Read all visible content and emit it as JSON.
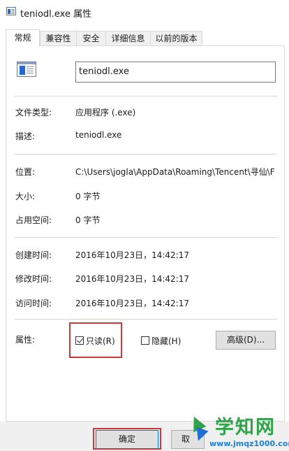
{
  "window": {
    "title": "teniodl.exe 属性"
  },
  "tabs": [
    {
      "label": "常规",
      "active": true
    },
    {
      "label": "兼容性",
      "active": false
    },
    {
      "label": "安全",
      "active": false
    },
    {
      "label": "详细信息",
      "active": false
    },
    {
      "label": "以前的版本",
      "active": false
    }
  ],
  "general": {
    "file_name": "teniodl.exe",
    "rows": {
      "type": {
        "label": "文件类型:",
        "value": "应用程序 (.exe)"
      },
      "description": {
        "label": "描述:",
        "value": "teniodl.exe"
      },
      "location": {
        "label": "位置:",
        "value": "C:\\Users\\jogla\\AppData\\Roaming\\Tencent\\寻仙\\F"
      },
      "size": {
        "label": "大小:",
        "value": "0 字节"
      },
      "size_on_disk": {
        "label": "占用空间:",
        "value": "0 字节"
      },
      "created": {
        "label": "创建时间:",
        "value": "2016年10月23日，14:42:17"
      },
      "modified": {
        "label": "修改时间:",
        "value": "2016年10月23日，14:42:17"
      },
      "accessed": {
        "label": "访问时间:",
        "value": "2016年10月23日，14:42:17"
      }
    },
    "attributes": {
      "label": "属性:",
      "readonly": {
        "label": "只读(R)",
        "checked": true
      },
      "hidden": {
        "label": "隐藏(H)",
        "checked": false
      },
      "advanced_button": "高级(D)..."
    }
  },
  "footer": {
    "ok_label": "确定",
    "cancel_label": "取"
  },
  "watermark": {
    "brand": "学知网",
    "url": "www.jmqz1000.com"
  },
  "colors": {
    "highlight": "#c9383b",
    "focus_border": "#0078d7",
    "watermark_green": "#2fa24a",
    "watermark_blue": "#1d7fd0"
  },
  "icons": [
    "app-title-icon",
    "exe-file-icon",
    "checkmark-icon"
  ]
}
